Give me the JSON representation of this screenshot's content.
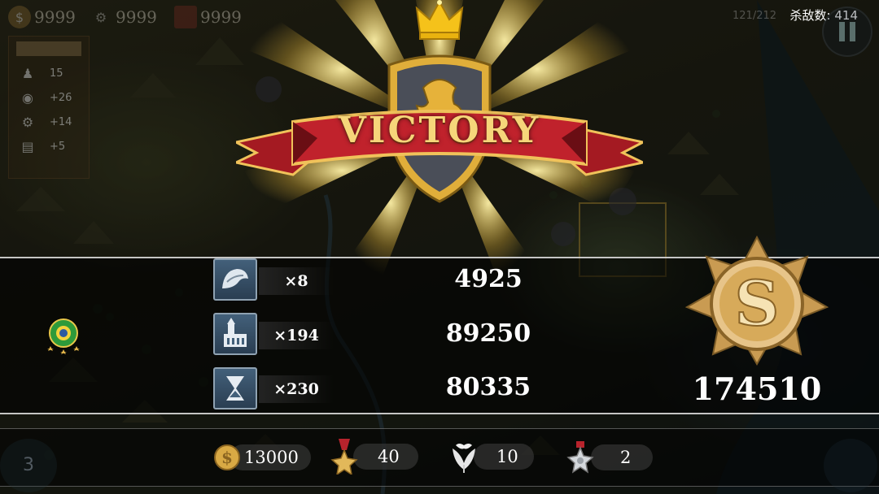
{
  "hud": {
    "resources": [
      {
        "icon": "gold-coin-icon",
        "value": "9999"
      },
      {
        "icon": "gear-icon",
        "value": "9999"
      },
      {
        "icon": "book-icon",
        "value": "9999"
      }
    ],
    "turn": "121/212",
    "kills_label": "杀敌数: 414"
  },
  "stats_panel": {
    "rows": [
      {
        "icon": "soldier-icon",
        "value": "15"
      },
      {
        "icon": "coin-icon",
        "value": "+26"
      },
      {
        "icon": "gear-icon",
        "value": "+14"
      },
      {
        "icon": "book-icon",
        "value": "+5"
      }
    ]
  },
  "banner": {
    "title": "VICTORY"
  },
  "results": {
    "rows": [
      {
        "icon": "helmet-icon",
        "multiplier": "×8",
        "score": "4925"
      },
      {
        "icon": "building-icon",
        "multiplier": "×194",
        "score": "89250"
      },
      {
        "icon": "hourglass-icon",
        "multiplier": "×230",
        "score": "80335"
      }
    ],
    "rank": "S",
    "total": "174510"
  },
  "rewards": [
    {
      "icon": "gold-coin-icon",
      "value": "13000"
    },
    {
      "icon": "medal-icon",
      "value": "40"
    },
    {
      "icon": "laurel-icon",
      "value": "10"
    },
    {
      "icon": "silver-medal-icon",
      "value": "2"
    }
  ],
  "corner_left": "3",
  "colors": {
    "gold": "#f6d67a",
    "ribbon_red": "#b8202a",
    "band_line": "#e6e6e6",
    "icon_blue": "#43607a"
  }
}
